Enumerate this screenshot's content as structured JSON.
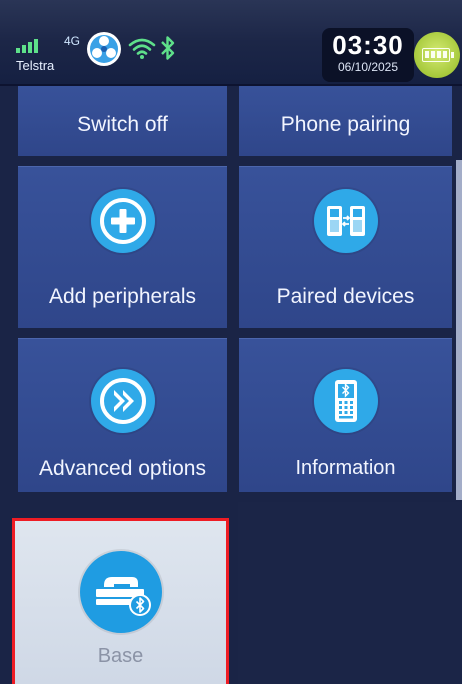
{
  "status_bar": {
    "network_type": "4G",
    "carrier": "Telstra",
    "time": "03:30",
    "date": "06/10/2025",
    "battery_level_percent": 80
  },
  "menu": {
    "tiles": [
      {
        "label": "Switch off",
        "icon": "power-icon"
      },
      {
        "label": "Phone pairing",
        "icon": "phone-pairing-icon"
      },
      {
        "label": "Add peripherals",
        "icon": "plus-circle-icon"
      },
      {
        "label": "Paired devices",
        "icon": "paired-devices-icon"
      },
      {
        "label": "Advanced options",
        "icon": "double-chevron-icon"
      },
      {
        "label": "Information",
        "icon": "terminal-bluetooth-icon"
      },
      {
        "label": "Base",
        "icon": "base-station-icon",
        "selected": true
      }
    ]
  },
  "colors": {
    "tile": "#324a8e",
    "icon_circle": "#2fa9e8",
    "selected_tile": "#d7dfea",
    "selection_border": "#ee1c24",
    "battery": "#a6c93b",
    "background": "#1a2446"
  }
}
